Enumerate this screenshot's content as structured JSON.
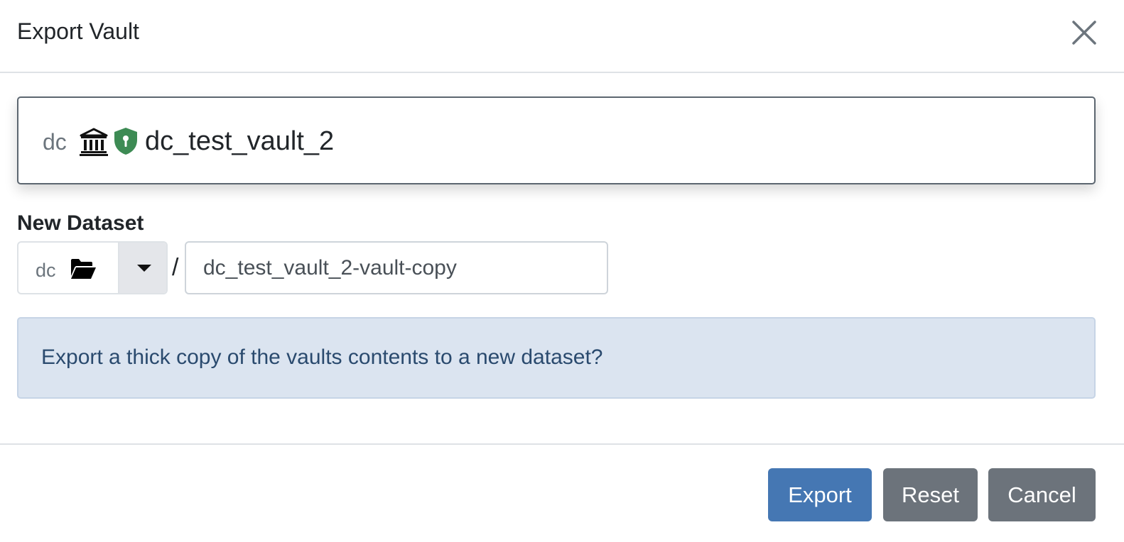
{
  "header": {
    "title": "Export Vault",
    "close_icon": "close-icon"
  },
  "vault": {
    "prefix": "dc",
    "icons": [
      "bank-icon",
      "shield-keyhole-icon"
    ],
    "name": "dc_test_vault_2",
    "shield_color": "#3d8b54"
  },
  "new_dataset": {
    "label": "New Dataset",
    "namespace": "dc",
    "namespace_icon": "folder-open-icon",
    "separator": "/",
    "name_value": "dc_test_vault_2-vault-copy"
  },
  "alert": {
    "text": "Export a thick copy of the vaults contents to a new dataset?",
    "background_color": "#dbe4f0"
  },
  "footer": {
    "export_label": "Export",
    "reset_label": "Reset",
    "cancel_label": "Cancel",
    "primary_color": "#4577b3",
    "secondary_color": "#6c737b"
  }
}
